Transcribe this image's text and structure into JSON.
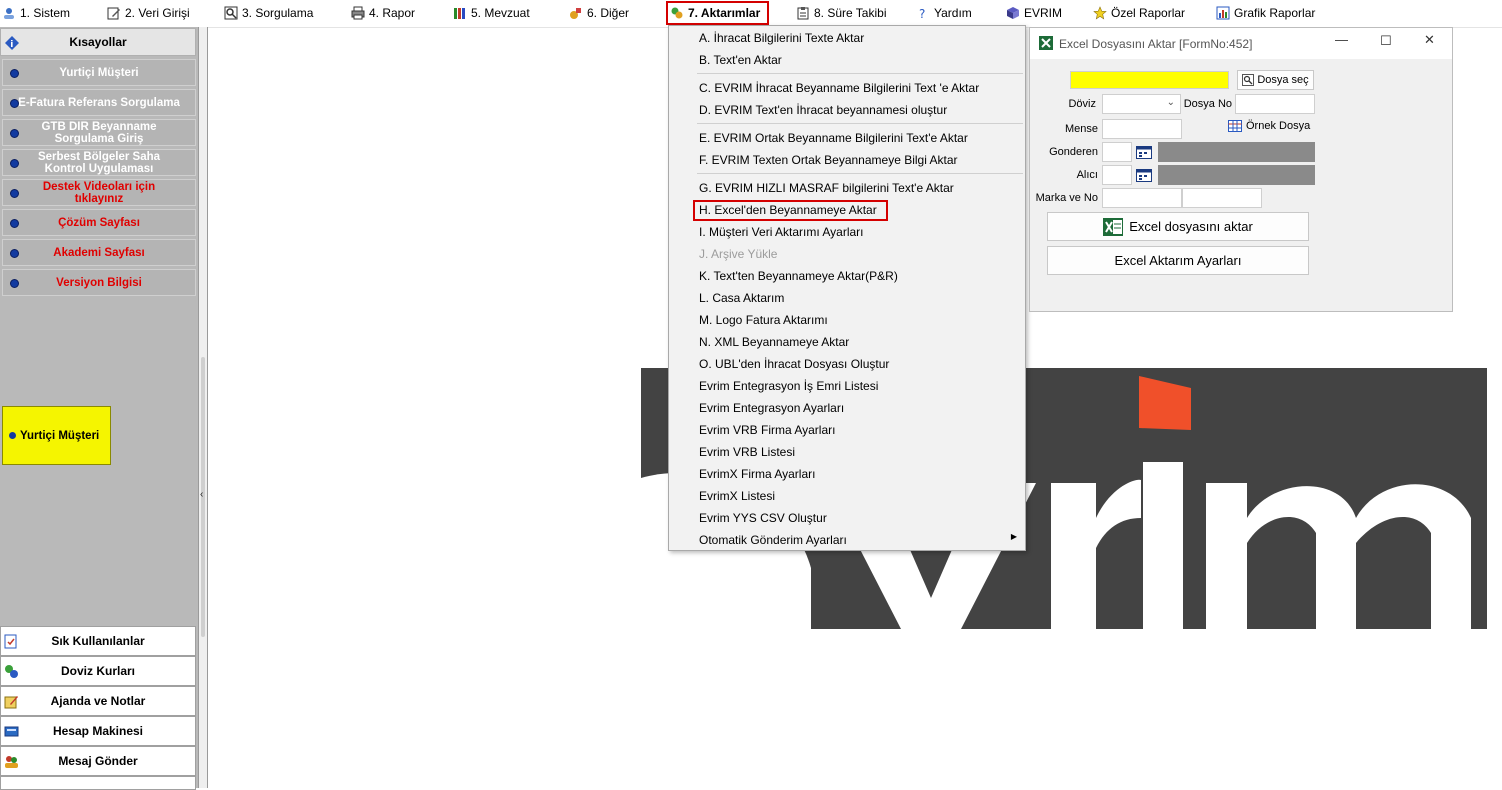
{
  "menubar": {
    "items": [
      {
        "label": "1.  Sistem",
        "icon": "gear-user-icon"
      },
      {
        "label": "2.  Veri Girişi",
        "icon": "edit-icon"
      },
      {
        "label": "3.  Sorgulama",
        "icon": "search-icon"
      },
      {
        "label": "4.  Rapor",
        "icon": "printer-icon"
      },
      {
        "label": "5.  Mevzuat",
        "icon": "books-icon"
      },
      {
        "label": "6.  Diğer",
        "icon": "tools-icon"
      },
      {
        "label": "7.  Aktarımlar",
        "icon": "transfer-icon"
      },
      {
        "label": "8. Süre Takibi",
        "icon": "clipboard-icon"
      },
      {
        "label": "Yardım",
        "icon": "help-icon"
      },
      {
        "label": "EVRIM",
        "icon": "evrim-icon"
      },
      {
        "label": "Özel Raporlar",
        "icon": "star-icon"
      },
      {
        "label": "Grafik Raporlar",
        "icon": "chart-icon"
      }
    ]
  },
  "sidebar": {
    "header": "Kısayollar",
    "items": [
      {
        "label": "Yurtiçi Müşteri",
        "red": false
      },
      {
        "label": "E-Fatura Referans Sorgulama",
        "red": false
      },
      {
        "label": "GTB DIR Beyanname Sorgulama Giriş",
        "red": false
      },
      {
        "label": "Serbest Bölgeler Saha Kontrol Uygulaması",
        "red": false
      },
      {
        "label": "Destek Videoları için tıklayınız",
        "red": true
      },
      {
        "label": "Çözüm Sayfası",
        "red": true
      },
      {
        "label": "Akademi Sayfası",
        "red": true
      },
      {
        "label": "Versiyon Bilgisi",
        "red": true
      }
    ],
    "selected": "Yurtiçi Müşteri",
    "bottom": [
      "Sık Kullanılanlar",
      "Doviz Kurları",
      "Ajanda ve Notlar",
      "Hesap Makinesi",
      "Mesaj Gönder"
    ]
  },
  "dropdown": {
    "items": [
      "A.   İhracat Bilgilerini Texte  Aktar",
      "B.   Text'en Aktar",
      "C.   EVRIM İhracat Beyanname Bilgilerini Text 'e Aktar",
      "D.   EVRIM Text'en İhracat beyannamesi oluştur",
      "E.   EVRIM Ortak Beyanname Bilgilerini Text'e Aktar",
      "F.   EVRIM Texten  Ortak Beyannameye Bilgi Aktar",
      "G.   EVRIM HIZLI MASRAF  bilgilerini Text'e Aktar",
      "H.   Excel'den Beyannameye Aktar",
      "I.   Müşteri Veri Aktarımı Ayarları",
      "J.   Arşive Yükle",
      "K.   Text'ten Beyannameye Aktar(P&R)",
      "L.   Casa Aktarım",
      "M. Logo Fatura Aktarımı",
      "N. XML Beyannameye Aktar",
      "O. UBL'den İhracat Dosyası Oluştur",
      "Evrim Entegrasyon İş Emri Listesi",
      "Evrim Entegrasyon Ayarları",
      "Evrim VRB Firma Ayarları",
      "Evrim VRB Listesi",
      "EvrimX Firma Ayarları",
      "EvrimX Listesi",
      "Evrim YYS CSV Oluştur",
      "Otomatik Gönderim Ayarları"
    ],
    "disabled_index": 9,
    "highlighted_index": 7
  },
  "dialog": {
    "title": "Excel Dosyasını Aktar  [FormNo:452]",
    "file_input_value": "",
    "browse_label": "Dosya seç",
    "doviz_label": "Döviz",
    "doviz_value": "",
    "dosya_no_label": "Dosya No",
    "mense_label": "Mense",
    "ornek_label": "Örnek Dosya",
    "gonderen_label": "Gonderen",
    "alici_label": "Alıcı",
    "marka_label": "Marka ve No",
    "import_button": "Excel dosyasını aktar",
    "settings_button": "Excel Aktarım Ayarları"
  },
  "colors": {
    "accent_red": "#d40000",
    "sidebar_gray": "#b9b9b9",
    "highlight_yellow": "#f5f500",
    "logo_bg": "#434343",
    "logo_orange": "#f0502a"
  }
}
